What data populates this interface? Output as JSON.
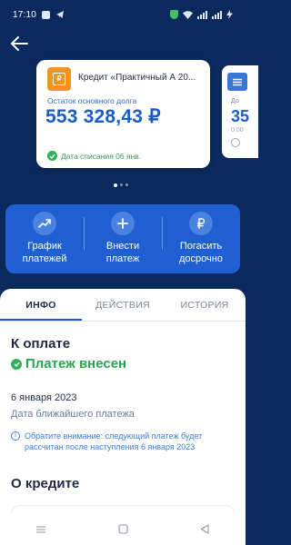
{
  "status_bar": {
    "time": "17:10"
  },
  "loan_card": {
    "name": "Кредит «Практичный А 20...",
    "balance_label": "Остаток основного долга",
    "balance": "553 328,43 ₽",
    "due_text": "Дата списания 06 янв."
  },
  "next_card": {
    "label": "До",
    "amount": "35",
    "sub": "0.00"
  },
  "actions": [
    {
      "label": "График\nплатежей",
      "icon": "trend-up-icon"
    },
    {
      "label": "Внести\nплатеж",
      "icon": "plus-icon"
    },
    {
      "label": "Погасить\nдосрочно",
      "icon": "ruble-icon"
    }
  ],
  "tabs": [
    {
      "label": "ИНФО",
      "active": true
    },
    {
      "label": "ДЕЙСТВИЯ",
      "active": false
    },
    {
      "label": "ИСТОРИЯ",
      "active": false
    }
  ],
  "info": {
    "section_title": "К оплате",
    "payment_status": "Платеж внесен",
    "next_date": "6 января 2023",
    "next_date_label": "Дата ближайшего платежа",
    "note": "Обратите внимание: следующий платеж будет рассчитан после наступления 6 января 2023"
  },
  "about_title": "О кредите",
  "colors": {
    "accent": "#1b5cc8",
    "success": "#2aa54e",
    "background": "#0a2a5e"
  }
}
